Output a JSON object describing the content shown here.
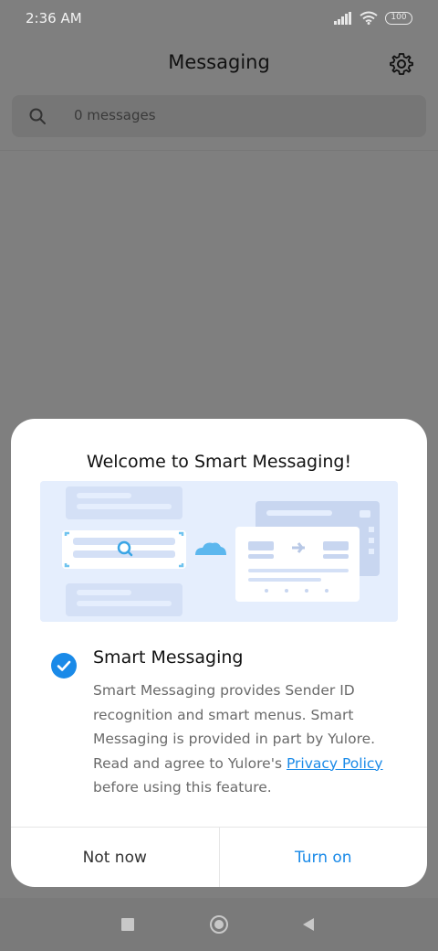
{
  "status_bar": {
    "time": "2:36 AM",
    "battery": "100"
  },
  "header": {
    "title": "Messaging"
  },
  "search": {
    "placeholder": "0 messages"
  },
  "dialog": {
    "title": "Welcome to Smart Messaging!",
    "option_title": "Smart Messaging",
    "description_before": "Smart Messaging provides Sender ID recognition and smart menus. Smart Messaging is provided in part by Yulore. Read and agree to Yulore's ",
    "privacy_link": "Privacy Policy",
    "description_after": " before using this feature.",
    "checked": true,
    "not_now_label": "Not now",
    "turn_on_label": "Turn on"
  },
  "colors": {
    "accent": "#1a8ae8",
    "overlay": "#7f7f7f",
    "illustration_bg": "#e5eefd"
  },
  "icons": {
    "settings": "gear-icon",
    "search": "search-icon",
    "check": "check-circle-icon",
    "nav_recents": "square-icon",
    "nav_home": "circle-icon",
    "nav_back": "triangle-back-icon"
  }
}
